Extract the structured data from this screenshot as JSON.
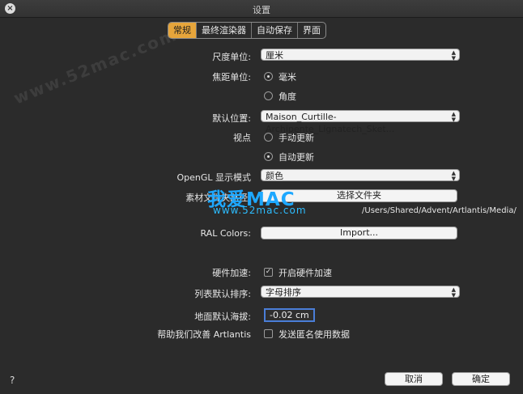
{
  "window": {
    "title": "设置"
  },
  "tabs": [
    {
      "label": "常规",
      "active": true
    },
    {
      "label": "最终渲染器",
      "active": false
    },
    {
      "label": "自动保存",
      "active": false
    },
    {
      "label": "界面",
      "active": false
    }
  ],
  "fields": {
    "size_unit_label": "尺度单位:",
    "size_unit_value": "厘米",
    "focal_unit_label": "焦距单位:",
    "focal_opt1": "毫米",
    "focal_opt2": "角度",
    "default_location_label": "默认位置:",
    "default_location_value": "Maison_Curtille-Archipente_Lignatech_Sket...",
    "viewpoint_label": "视点",
    "view_opt1": "手动更新",
    "view_opt2": "自动更新",
    "opengl_label": "OpenGL 显示模式",
    "opengl_value": "颜色",
    "material_label": "素材文件夹路径:",
    "choose_folder_button": "选择文件夹",
    "material_path": "/Users/Shared/Advent/Artlantis/Media/",
    "ral_label": "RAL Colors:",
    "import_button": "Import...",
    "hw_accel_label": "硬件加速:",
    "hw_accel_option": "开启硬件加速",
    "list_sort_label": "列表默认排序:",
    "list_sort_value": "字母排序",
    "ground_label": "地面默认海拔:",
    "ground_value": "-0.02 cm",
    "help_label": "帮助我们改善 Artlantis",
    "help_option": "发送匿名使用数据"
  },
  "footer": {
    "cancel": "取消",
    "ok": "确定",
    "help": "?"
  },
  "watermarks": {
    "top": "www.52mac.com",
    "brand": "我爱MAC",
    "url": "www.52mac.com"
  },
  "colors": {
    "accent_tab": "#e6a53b",
    "focus": "#4a7ed8"
  }
}
